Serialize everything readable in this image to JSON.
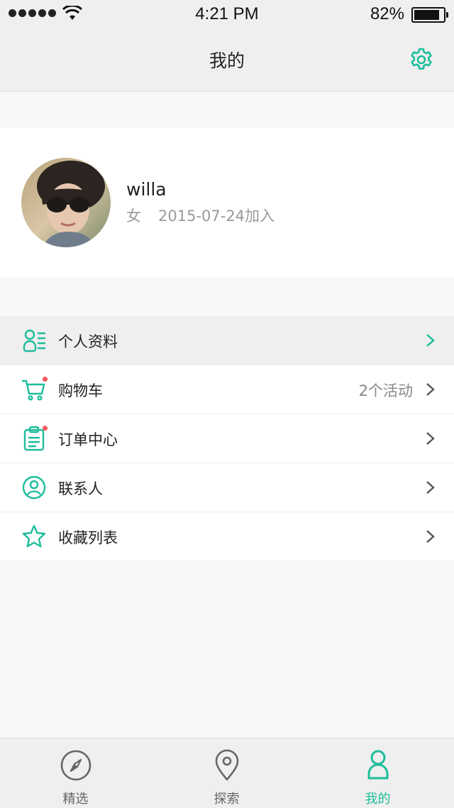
{
  "status": {
    "time": "4:21 PM",
    "battery": "82%"
  },
  "nav": {
    "title": "我的",
    "settings_icon": "gear-icon"
  },
  "profile": {
    "name": "willa",
    "gender": "女",
    "joined": "2015-07-24加入"
  },
  "menu": [
    {
      "label": "个人资料",
      "icon": "profile-card-icon",
      "extra": "",
      "has_dot": false,
      "active": true
    },
    {
      "label": "购物车",
      "icon": "cart-icon",
      "extra": "2个活动",
      "has_dot": true,
      "active": false
    },
    {
      "label": "订单中心",
      "icon": "clipboard-icon",
      "extra": "",
      "has_dot": true,
      "active": false
    },
    {
      "label": "联系人",
      "icon": "contact-icon",
      "extra": "",
      "has_dot": false,
      "active": false
    },
    {
      "label": "收藏列表",
      "icon": "star-icon",
      "extra": "",
      "has_dot": false,
      "active": false
    }
  ],
  "tabs": [
    {
      "label": "精选",
      "icon": "compass-icon",
      "active": false
    },
    {
      "label": "探索",
      "icon": "location-pin-icon",
      "active": false
    },
    {
      "label": "我的",
      "icon": "person-icon",
      "active": true
    }
  ],
  "colors": {
    "accent": "#1dbd9b",
    "badge": "#f1595c"
  }
}
